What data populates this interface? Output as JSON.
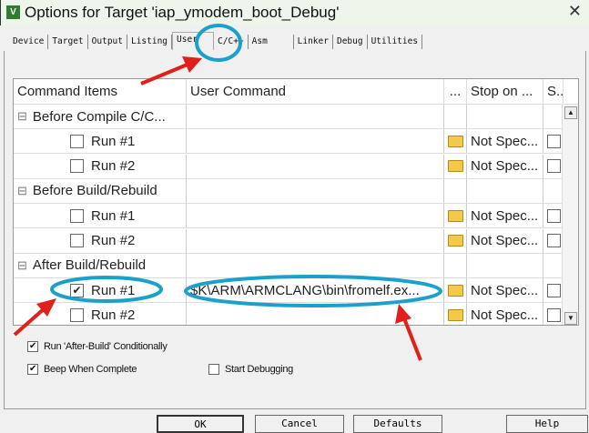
{
  "window": {
    "title": "Options for Target 'iap_ymodem_boot_Debug'",
    "close": "✕"
  },
  "tabs": [
    "Device",
    "Target",
    "Output",
    "Listing",
    "User",
    "C/C++",
    "Asm",
    "Linker",
    "Debug",
    "Utilities"
  ],
  "active_tab": "User",
  "grid": {
    "headers": [
      "Command Items",
      "User Command",
      "...",
      "Stop on ...",
      "S.."
    ],
    "rows": [
      {
        "label": "Before Compile C/C...",
        "group": true
      },
      {
        "label": "Run #1",
        "checked": false,
        "command": "",
        "stop": "Not Spec..."
      },
      {
        "label": "Run #2",
        "checked": false,
        "command": "",
        "stop": "Not Spec..."
      },
      {
        "label": "Before Build/Rebuild",
        "group": true
      },
      {
        "label": "Run #1",
        "checked": false,
        "command": "",
        "stop": "Not Spec..."
      },
      {
        "label": "Run #2",
        "checked": false,
        "command": "",
        "stop": "Not Spec..."
      },
      {
        "label": "After Build/Rebuild",
        "group": true
      },
      {
        "label": "Run #1",
        "checked": true,
        "command": "$K\\ARM\\ARMCLANG\\bin\\fromelf.ex...",
        "stop": "Not Spec..."
      },
      {
        "label": "Run #2",
        "checked": false,
        "command": "",
        "stop": "Not Spec..."
      }
    ]
  },
  "options": {
    "run_after_build": {
      "label": "Run 'After-Build' Conditionally",
      "checked": true
    },
    "beep": {
      "label": "Beep When Complete",
      "checked": true
    },
    "start_debugging": {
      "label": "Start Debugging",
      "checked": false
    }
  },
  "buttons": {
    "ok": "OK",
    "cancel": "Cancel",
    "defaults": "Defaults",
    "help": "Help"
  },
  "annotation_colors": {
    "circle": "#1ba1c9",
    "arrow": "#e0201c"
  }
}
